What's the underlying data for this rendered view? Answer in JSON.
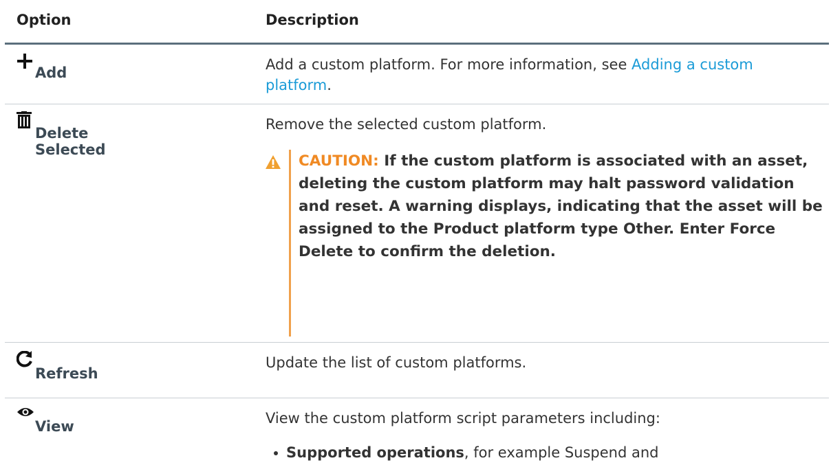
{
  "table": {
    "header": {
      "option": "Option",
      "description": "Description"
    },
    "rows": [
      {
        "icon": "plus-icon",
        "label": "Add",
        "description_prefix": "Add a custom platform. For more information, see ",
        "link_text": "Adding a custom platform",
        "description_suffix": "."
      },
      {
        "icon": "trash-icon",
        "label": "Delete Selected",
        "description": "Remove the selected custom platform.",
        "caution": {
          "icon": "warning-icon",
          "label": "CAUTION:",
          "text": "If the custom platform is associated with an asset, deleting the custom platform may halt password validation and reset. A warning displays, indicating that the asset will be assigned to the Product platform type Other. Enter Force Delete to confirm the deletion."
        }
      },
      {
        "icon": "refresh-icon",
        "label": "Refresh",
        "description": "Update the list of custom platforms."
      },
      {
        "icon": "eye-icon",
        "label": "View",
        "description": "View the custom platform script parameters including:",
        "bullets": [
          {
            "strong": "Supported operations",
            "text": ", for example Suspend and"
          }
        ]
      }
    ]
  },
  "colors": {
    "link": "#1a9bd7",
    "caution": "#f08a24",
    "caution_bar": "#f0a04b",
    "header_rule": "#5a6f7c"
  }
}
